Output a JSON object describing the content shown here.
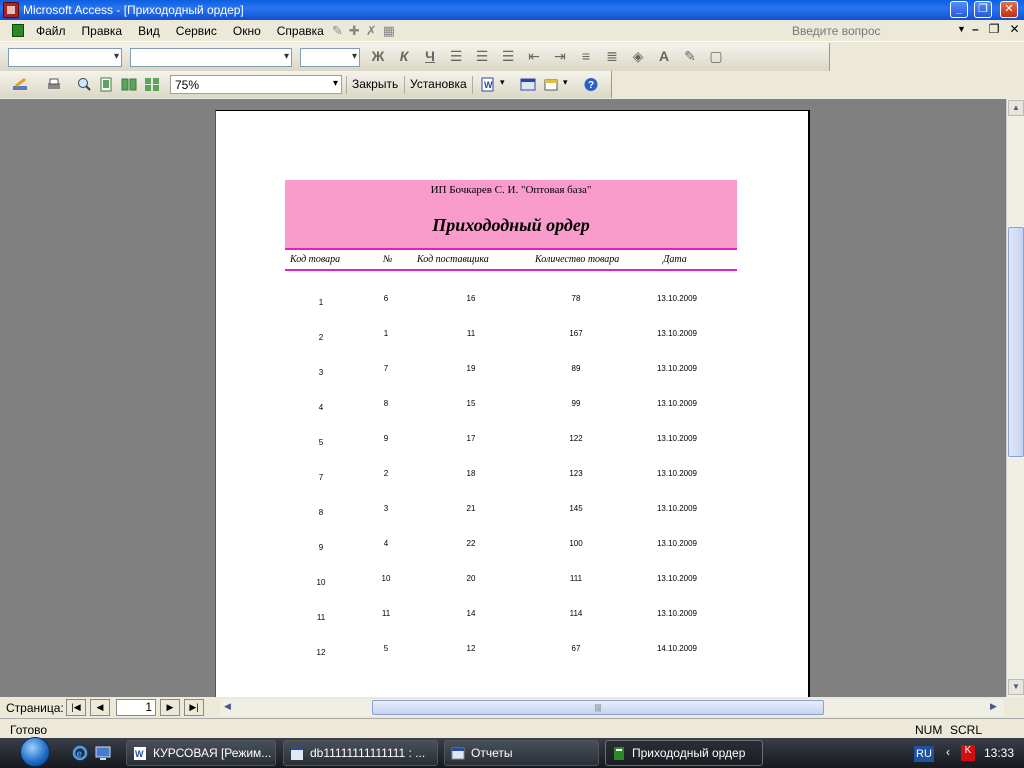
{
  "window": {
    "title": "Microsoft Access - [Прихододный ордер]"
  },
  "menu": {
    "items": [
      "Файл",
      "Правка",
      "Вид",
      "Сервис",
      "Окно",
      "Справка"
    ],
    "question_placeholder": "Введите вопрос"
  },
  "preview_toolbar": {
    "zoom": "75%",
    "close_label": "Закрыть",
    "setup_label": "Установка"
  },
  "report": {
    "company": "ИП Бочкарев С. И. \"Оптовая база\"",
    "title": "Прихододный ордер",
    "columns": [
      "Код товара",
      "№",
      "Код поставщика",
      "Количество товара",
      "Дата"
    ],
    "rows": [
      [
        "1",
        "6",
        "16",
        "78",
        "13.10.2009"
      ],
      [
        "2",
        "1",
        "11",
        "167",
        "13.10.2009"
      ],
      [
        "3",
        "7",
        "19",
        "89",
        "13.10.2009"
      ],
      [
        "4",
        "8",
        "15",
        "99",
        "13.10.2009"
      ],
      [
        "5",
        "9",
        "17",
        "122",
        "13.10.2009"
      ],
      [
        "7",
        "2",
        "18",
        "123",
        "13.10.2009"
      ],
      [
        "8",
        "3",
        "21",
        "145",
        "13.10.2009"
      ],
      [
        "9",
        "4",
        "22",
        "100",
        "13.10.2009"
      ],
      [
        "10",
        "10",
        "20",
        "111",
        "13.10.2009"
      ],
      [
        "11",
        "11",
        "14",
        "114",
        "13.10.2009"
      ],
      [
        "12",
        "5",
        "12",
        "67",
        "14.10.2009"
      ]
    ]
  },
  "navigation": {
    "page_label": "Страница:",
    "current_page": "1"
  },
  "statusbar": {
    "status": "Готово",
    "num": "NUM",
    "scrl": "SCRL"
  },
  "taskbar": {
    "tasks": [
      "КУРСОВАЯ [Режим...",
      "db11111111111111 : ...",
      "Отчеты",
      "Прихододный ордер"
    ],
    "lang": "RU",
    "clock": "13:33"
  }
}
